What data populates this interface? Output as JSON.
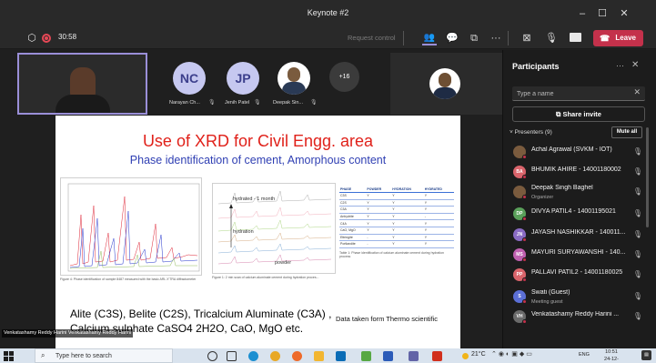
{
  "window": {
    "title": "Keynote #2"
  },
  "toolbar": {
    "timer": "30:58",
    "request_control": "Request control",
    "leave_label": "Leave",
    "colors": {
      "leave": "#c4314b",
      "recording": "#e74856"
    }
  },
  "stage": {
    "participants": [
      {
        "initials": "NC",
        "name": "Narayan Ch...",
        "color": "#6264a7"
      },
      {
        "initials": "JP",
        "name": "Jenih Patel",
        "color": "#6264a7"
      },
      {
        "initials": "",
        "name": "Deepak Sin...",
        "color": "#ffffff"
      }
    ],
    "overflow_count": "+16",
    "speaker_label": "Venkatashamy Reddy Harini Venkatashamy Reddy Harini"
  },
  "slide": {
    "title": "Use of XRD  for Civil Engg. area",
    "subtitle": "Phase identification of cement, Amorphous content",
    "fig1_caption": "Figure 4: Phase identification of sample 8487 measured with the basic ARL X'TRA diffractometer",
    "fig2_caption": "Figure 1: 2 min scan of calcium aluminate cement during hydration proces...",
    "fig2_labels": {
      "top": "hydrated - 1 month",
      "mid": "hydration",
      "bottom": "powder"
    },
    "table": {
      "headers": [
        "PHASE",
        "POWDER",
        "HYDRATION",
        "HYDRATED"
      ],
      "rows": [
        [
          "C3S",
          "Y",
          "Y",
          "Y"
        ],
        [
          "C2S",
          "Y",
          "Y",
          "Y"
        ],
        [
          "C3A",
          "Y",
          "Y",
          "Y"
        ],
        [
          "Anhydrite",
          "Y",
          "Y",
          "-"
        ],
        [
          "C4A",
          "Y",
          "Y",
          "Y"
        ],
        [
          "CaO, MgO",
          "Y",
          "Y",
          "Y"
        ],
        [
          "Ettringite",
          "-",
          "Y",
          "Y"
        ],
        [
          "Portlandite",
          "-",
          "Y",
          "Y"
        ]
      ],
      "caption": "Table 1: Phase identification of calcium aluminate cement during hydration process"
    },
    "body_line1": "Alite (C3S), Belite (C2S), Tricalcium Aluminate (C3A) ,",
    "body_line2": "Calcium sulphate CaSO4 2H2O, CaO, MgO etc.",
    "data_source": "Data taken form Thermo scientific"
  },
  "panel": {
    "title": "Participants",
    "search_placeholder": "Type a name",
    "share_invite": "Share invite",
    "presenters_label": "Presenters (9)",
    "mute_all": "Mute all",
    "people": [
      {
        "initials": "",
        "name": "Achal Agrawal (SVKM - IOT)",
        "sub": "",
        "color": "#7a5b3e"
      },
      {
        "initials": "BA",
        "name": "BHUMIK AHIRE - 14001180002",
        "sub": "",
        "color": "#d9646b"
      },
      {
        "initials": "",
        "name": "Deepak Singh Baghel",
        "sub": "Organizer",
        "color": "#7a5b3e"
      },
      {
        "initials": "DP",
        "name": "DIVYA PATIL4 - 14001195021",
        "sub": "",
        "color": "#5aa05a"
      },
      {
        "initials": "JN",
        "name": "JAYASH NASHIKKAR - 140011...",
        "sub": "",
        "color": "#8a6bc4"
      },
      {
        "initials": "MS",
        "name": "MAYURI SURYAWANSHI - 140...",
        "sub": "",
        "color": "#c060b0"
      },
      {
        "initials": "PP",
        "name": "PALLAVI PATIL2 - 14001180025",
        "sub": "",
        "color": "#d9646b"
      },
      {
        "initials": "S",
        "name": "Swati (Guest)",
        "sub": "Meeting guest",
        "color": "#5b6fd6"
      },
      {
        "initials": "VH",
        "name": "Venkatashamy Reddy Harini ...",
        "sub": "",
        "color": "#6b6b6b"
      }
    ]
  },
  "taskbar": {
    "search_text": "Type here to search",
    "temperature": "21°C",
    "language": "ENG",
    "time": "10:51",
    "date": "24-12-2021"
  }
}
